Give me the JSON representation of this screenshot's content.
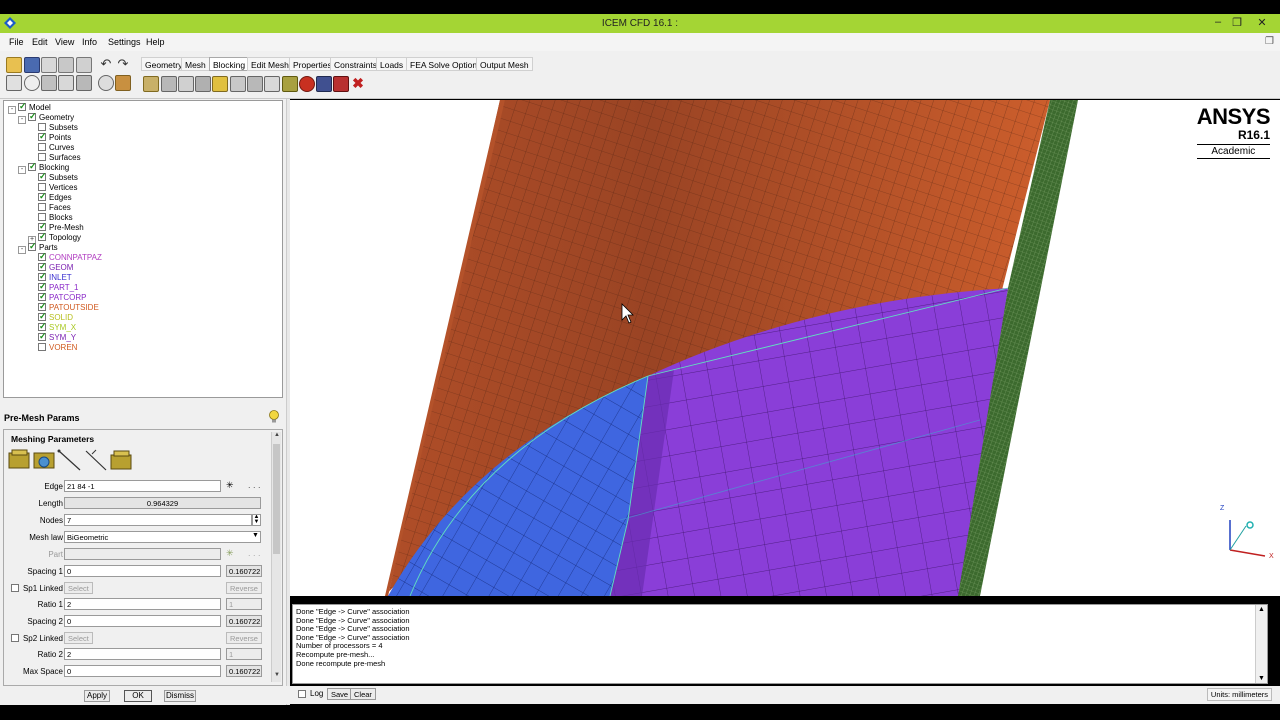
{
  "window": {
    "title": "ICEM CFD 16.1 :",
    "controls": [
      "–",
      "❐",
      "✕"
    ]
  },
  "menu": [
    "File",
    "Edit",
    "View",
    "Info",
    "Settings",
    "Help"
  ],
  "tabs": [
    "Geometry",
    "Mesh",
    "Blocking",
    "Edit Mesh",
    "Properties",
    "Constraints",
    "Loads",
    "FEA Solve Options",
    "Output Mesh"
  ],
  "active_tab": "Blocking",
  "tree": [
    {
      "label": "Model",
      "level": 0,
      "checked": true,
      "expander": "-"
    },
    {
      "label": "Geometry",
      "level": 1,
      "checked": true,
      "expander": "-"
    },
    {
      "label": "Subsets",
      "level": 2,
      "checked": false
    },
    {
      "label": "Points",
      "level": 2,
      "checked": true
    },
    {
      "label": "Curves",
      "level": 2,
      "checked": false
    },
    {
      "label": "Surfaces",
      "level": 2,
      "checked": false
    },
    {
      "label": "Blocking",
      "level": 1,
      "checked": true,
      "expander": "-"
    },
    {
      "label": "Subsets",
      "level": 2,
      "checked": true
    },
    {
      "label": "Vertices",
      "level": 2,
      "checked": false
    },
    {
      "label": "Edges",
      "level": 2,
      "checked": true
    },
    {
      "label": "Faces",
      "level": 2,
      "checked": false
    },
    {
      "label": "Blocks",
      "level": 2,
      "checked": false
    },
    {
      "label": "Pre-Mesh",
      "level": 2,
      "checked": true
    },
    {
      "label": "Topology",
      "level": 2,
      "checked": true,
      "expander": "+"
    },
    {
      "label": "Parts",
      "level": 1,
      "checked": true,
      "expander": "-"
    },
    {
      "label": "CONNPATPAZ",
      "level": 2,
      "checked": true,
      "color": "#b03ac0"
    },
    {
      "label": "GEOM",
      "level": 2,
      "checked": true,
      "color": "#7a1fb0"
    },
    {
      "label": "INLET",
      "level": 2,
      "checked": true,
      "color": "#3a2fd0"
    },
    {
      "label": "PART_1",
      "level": 2,
      "checked": true,
      "color": "#8a28c8"
    },
    {
      "label": "PATCORP",
      "level": 2,
      "checked": true,
      "color": "#8a28c8"
    },
    {
      "label": "PATOUTSIDE",
      "level": 2,
      "checked": true,
      "color": "#d05a20"
    },
    {
      "label": "SOLID",
      "level": 2,
      "checked": true,
      "color": "#b8c020"
    },
    {
      "label": "SYM_X",
      "level": 2,
      "checked": true,
      "color": "#a8c820"
    },
    {
      "label": "SYM_Y",
      "level": 2,
      "checked": true,
      "color": "#7a1fb0"
    },
    {
      "label": "VOREN",
      "level": 2,
      "checked": false,
      "color": "#d05a20"
    }
  ],
  "params": {
    "title": "Pre-Mesh Params",
    "section": "Meshing Parameters",
    "edge_label": "Edge",
    "edge_value": "21 84 -1",
    "length_label": "Length",
    "length_value": "0.964329",
    "nodes_label": "Nodes",
    "nodes_value": "7",
    "meshlaw_label": "Mesh law",
    "meshlaw_value": "BiGeometric",
    "part_label": "Part",
    "spacing1_label": "Spacing 1",
    "spacing1_value": "0",
    "spacing1_actual": "0.160722",
    "sp1linked_label": "Sp1 Linked",
    "select_label": "Select",
    "reverse_label": "Reverse",
    "ratio1_label": "Ratio 1",
    "ratio1_value": "2",
    "ratio1_actual": "1",
    "spacing2_label": "Spacing 2",
    "spacing2_value": "0",
    "spacing2_actual": "0.160722",
    "sp2linked_label": "Sp2 Linked",
    "ratio2_label": "Ratio 2",
    "ratio2_value": "2",
    "ratio2_actual": "1",
    "maxspace_label": "Max Space",
    "maxspace_value": "0",
    "maxspace_actual": "0.160722",
    "apply": "Apply",
    "ok": "OK",
    "dismiss": "Dismiss"
  },
  "brand": {
    "name": "ANSYS",
    "version": "R16.1",
    "edition": "Academic"
  },
  "axes": {
    "z": "Z",
    "x": "X"
  },
  "log": [
    "Done \"Edge -> Curve\" association",
    "Done \"Edge -> Curve\" association",
    "Done \"Edge -> Curve\" association",
    "Done \"Edge -> Curve\" association",
    "Number of processors = 4",
    "Recompute pre-mesh...",
    "Done recompute pre-mesh"
  ],
  "bottom": {
    "log_label": "Log",
    "save": "Save",
    "clear": "Clear",
    "units": "Units: millimeters"
  },
  "colors": {
    "titlebar": "#a4d534",
    "mesh_orange": "#c4562a",
    "mesh_purple": "#8a3ed8",
    "mesh_blue": "#3f66e0",
    "mesh_green_edge": "#3a6a30"
  }
}
